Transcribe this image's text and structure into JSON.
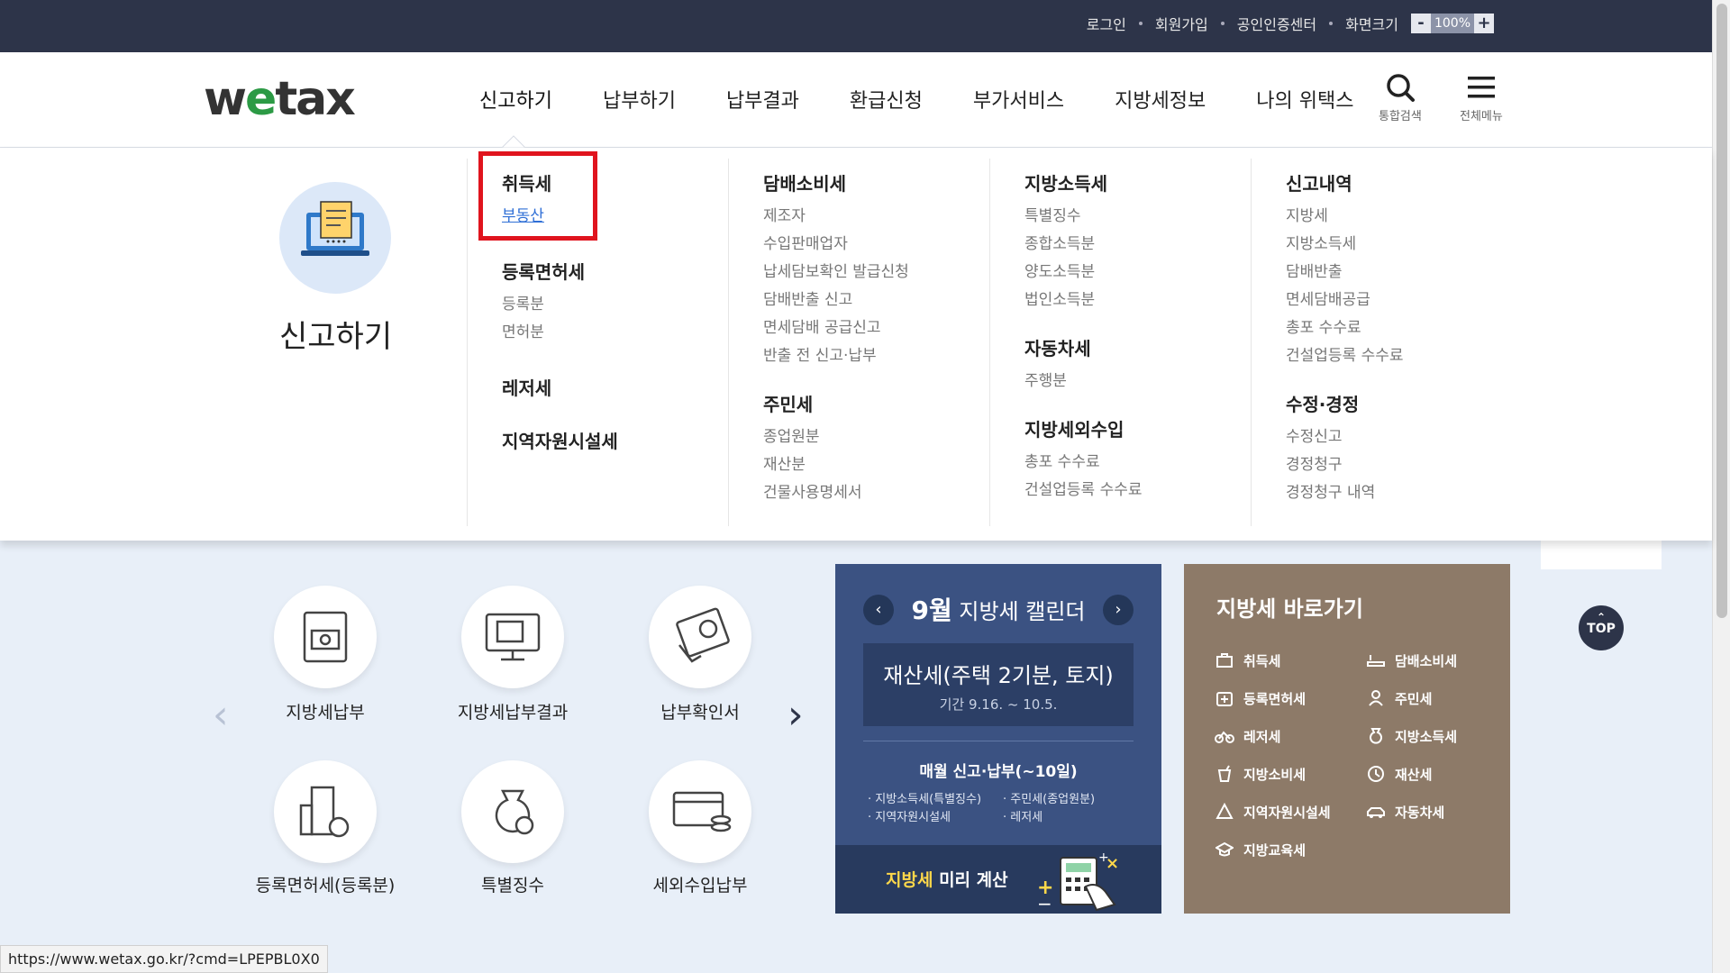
{
  "topbar": {
    "links": [
      "로그인",
      "회원가입",
      "공인인증센터",
      "화면크기"
    ],
    "zoom_minus": "-",
    "zoom_value": "100%",
    "zoom_plus": "+"
  },
  "header": {
    "logo_pre": "w",
    "logo_e": "e",
    "logo_post": "tax",
    "menus": [
      "신고하기",
      "납부하기",
      "납부결과",
      "환급신청",
      "부가서비스",
      "지방세정보",
      "나의 위택스"
    ],
    "search_label": "통합검색",
    "allmenu_label": "전체메뉴"
  },
  "dropdown": {
    "title": "신고하기",
    "col1": [
      {
        "title": "취득세",
        "items": [
          "부동산"
        ]
      },
      {
        "title": "등록면허세",
        "items": [
          "등록분",
          "면허분"
        ]
      },
      {
        "title": "레저세",
        "items": []
      },
      {
        "title": "지역자원시설세",
        "items": []
      }
    ],
    "col2": [
      {
        "title": "담배소비세",
        "items": [
          "제조자",
          "수입판매업자",
          "납세담보확인 발급신청",
          "담배반출 신고",
          "면세담배 공급신고",
          "반출 전 신고·납부"
        ]
      },
      {
        "title": "주민세",
        "items": [
          "종업원분",
          "재산분",
          "건물사용명세서"
        ]
      }
    ],
    "col3": [
      {
        "title": "지방소득세",
        "items": [
          "특별징수",
          "종합소득분",
          "양도소득분",
          "법인소득분"
        ]
      },
      {
        "title": "자동차세",
        "items": [
          "주행분"
        ]
      },
      {
        "title": "지방세외수입",
        "items": [
          "총포 수수료",
          "건설업등록 수수료"
        ]
      }
    ],
    "col4": [
      {
        "title": "신고내역",
        "items": [
          "지방세",
          "지방소득세",
          "담배반출",
          "면세담배공급",
          "총포 수수료",
          "건설업등록 수수료"
        ]
      },
      {
        "title": "수정·경정",
        "items": [
          "수정신고",
          "경정청구",
          "경정청구 내역"
        ]
      }
    ]
  },
  "quicklinks": [
    "지방세납부",
    "지방세납부결과",
    "납부확인서",
    "등록면허세(등록분)",
    "특별징수",
    "세외수입납부"
  ],
  "calendar": {
    "month": "9월",
    "title": "지방세 캘린더",
    "prev": "‹",
    "next": "›",
    "item_title": "재산세(주택 2기분, 토지)",
    "item_period": "기간 9.16. ~ 10.5.",
    "monthly": "매월 신고·납부(~10일)",
    "tags": [
      "· 지방소득세(특별징수)",
      "· 주민세(종업원분)",
      "· 지역자원시설세",
      "· 레저세"
    ],
    "calc_highlight": "지방세",
    "calc_rest": " 미리 계산"
  },
  "shortcut": {
    "title": "지방세 바로가기",
    "items": [
      "취득세",
      "담배소비세",
      "등록면허세",
      "주민세",
      "레저세",
      "지방소득세",
      "지방소비세",
      "재산세",
      "지역자원시설세",
      "자동차세",
      "지방교육세"
    ]
  },
  "top_button": "TOP",
  "status_url": "https://www.wetax.go.kr/?cmd=LPEPBL0X0",
  "colors": {
    "topbar": "#2d3449",
    "calendar": "#3b5282",
    "shortcut": "#8d7a68",
    "highlight": "#e0141e",
    "logo_e": "#2c9a45"
  }
}
